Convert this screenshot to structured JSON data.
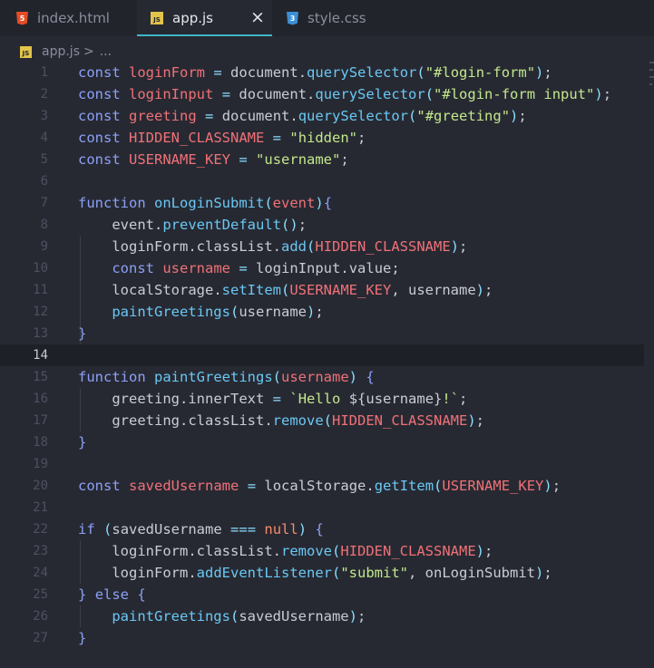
{
  "tabs": [
    {
      "label": "index.html",
      "icon": "html5-icon",
      "active": false
    },
    {
      "label": "app.js",
      "icon": "js-icon",
      "active": true
    },
    {
      "label": "style.css",
      "icon": "css3-icon",
      "active": false
    }
  ],
  "breadcrumb": {
    "file": "app.js",
    "separator": ">",
    "more": "..."
  },
  "icons": {
    "html_letter": "5",
    "js_letters": "JS",
    "css_letter": "3",
    "close_glyph": "×"
  },
  "editor": {
    "current_line": 14,
    "line_numbers": [
      "1",
      "2",
      "3",
      "4",
      "5",
      "6",
      "7",
      "8",
      "9",
      "10",
      "11",
      "12",
      "13",
      "14",
      "15",
      "16",
      "17",
      "18",
      "19",
      "20",
      "21",
      "22",
      "23",
      "24",
      "25",
      "26",
      "27"
    ],
    "lines": [
      "const loginForm = document.querySelector(\"#login-form\");",
      "const loginInput = document.querySelector(\"#login-form input\");",
      "const greeting = document.querySelector(\"#greeting\");",
      "const HIDDEN_CLASSNAME = \"hidden\";",
      "const USERNAME_KEY = \"username\";",
      "",
      "function onLoginSubmit(event){",
      "    event.preventDefault();",
      "    loginForm.classList.add(HIDDEN_CLASSNAME);",
      "    const username = loginInput.value;",
      "    localStorage.setItem(USERNAME_KEY, username);",
      "    paintGreetings(username);",
      "}",
      "",
      "function paintGreetings(username) {",
      "    greeting.innerText = `Hello ${username}!`;",
      "    greeting.classList.remove(HIDDEN_CLASSNAME);",
      "}",
      "",
      "const savedUsername = localStorage.getItem(USERNAME_KEY);",
      "",
      "if (savedUsername === null) {",
      "    loginForm.classList.remove(HIDDEN_CLASSNAME);",
      "    loginForm.addEventListener(\"submit\", onLoginSubmit);",
      "} else {",
      "    paintGreetings(savedUsername);",
      "}"
    ]
  },
  "colors": {
    "background": "#272932",
    "tabbar": "#22242c",
    "active_tab_underline": "#3fb6c7",
    "keyword": "#8ba0f5",
    "variable": "#f07178",
    "function": "#69c8f4",
    "string": "#c3e88d"
  }
}
